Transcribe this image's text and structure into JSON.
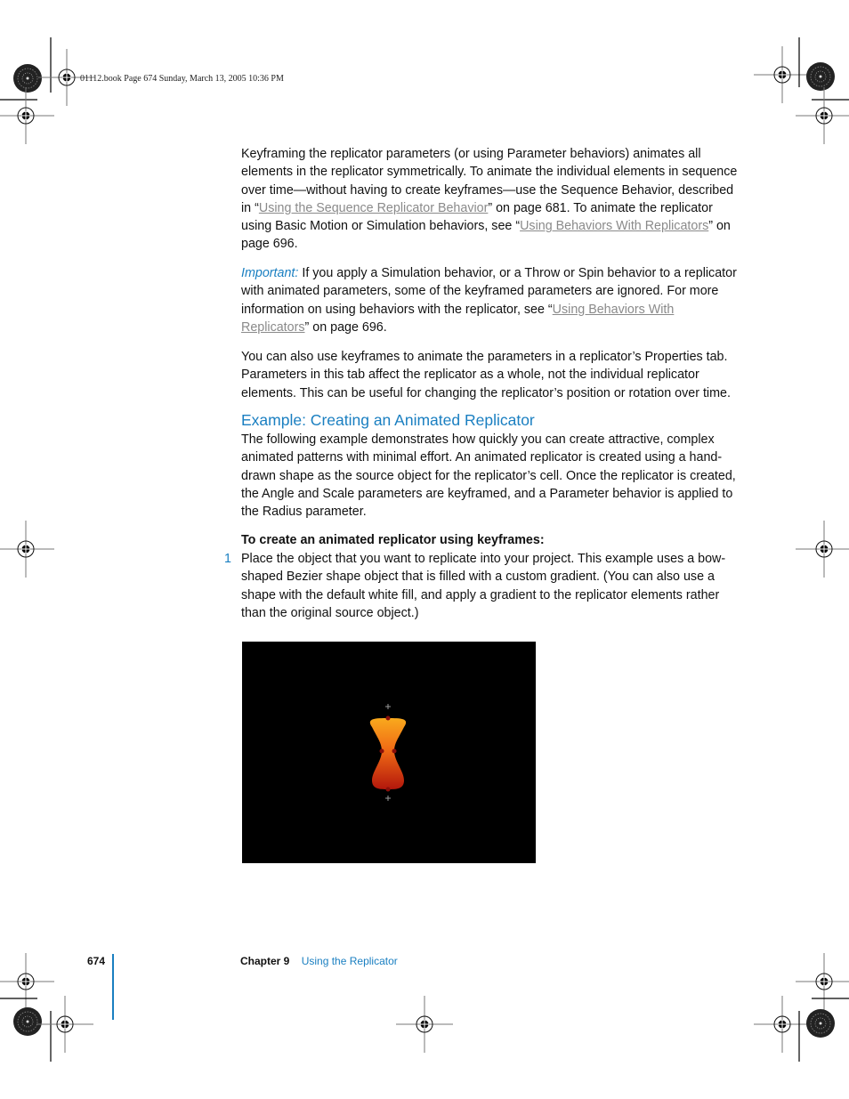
{
  "slug_line": "01112.book  Page 674  Sunday, March 13, 2005  10:36 PM",
  "paragraphs": {
    "p1": {
      "text_a": "Keyframing the replicator parameters (or using Parameter behaviors) animates all elements in the replicator symmetrically. To animate the individual elements in sequence over time—without having to create keyframes—use the Sequence Behavior, described in “",
      "link_1": "Using the Sequence Replicator Behavior",
      "text_b": "” on page 681. To animate the replicator using Basic Motion or Simulation behaviors, see “",
      "link_2": "Using Behaviors With Replicators",
      "text_c": "” on page 696."
    },
    "important": {
      "label": "Important:",
      "text_a": "  If you apply a Simulation behavior, or a Throw or Spin behavior to a replicator with animated parameters, some of the keyframed parameters are ignored. For more information on using behaviors with the replicator, see “",
      "link": "Using Behaviors With Replicators",
      "text_b": "” on page 696."
    },
    "p3": "You can also use keyframes to animate the parameters in a replicator’s Properties tab. Parameters in this tab affect the replicator as a whole, not the individual replicator elements. This can be useful for changing the replicator’s position or rotation over time."
  },
  "section": {
    "heading": "Example:  Creating an Animated Replicator",
    "intro": "The following example demonstrates how quickly you can create attractive, complex animated patterns with minimal effort. An animated replicator is created using a hand-drawn shape as the source object for the replicator’s cell. Once the replicator is created, the Angle and Scale parameters are keyframed, and a Parameter behavior is applied to the Radius parameter.",
    "procedure_title": "To create an animated replicator using keyframes:",
    "steps": [
      {
        "number": "1",
        "text": "Place the object that you want to replicate into your project. This example uses a bow-shaped Bezier shape object that is filled with a custom gradient. (You can also use a shape with the default white fill, and apply a gradient to the replicator elements rather than the original source object.)"
      }
    ]
  },
  "figure": {
    "description": "bow-shaped Bezier shape with orange-to-red gradient on black canvas",
    "gradient_top": "#f7a21b",
    "gradient_bottom": "#b3170c",
    "background": "#000000"
  },
  "footer": {
    "page_number": "674",
    "chapter_label": "Chapter 9",
    "chapter_title": "Using the Replicator"
  },
  "colors": {
    "accent": "#1a7fc1",
    "link": "#8a8a8a",
    "text": "#111111"
  }
}
